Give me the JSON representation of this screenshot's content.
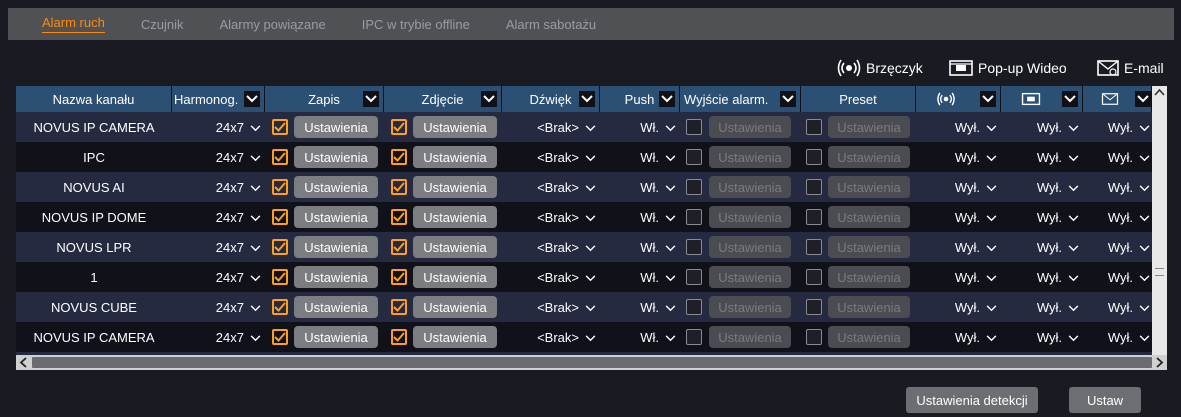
{
  "tabs": [
    "Alarm ruch",
    "Czujnik",
    "Alarmy powiązane",
    "IPC w trybie offline",
    "Alarm sabotażu"
  ],
  "legend": {
    "buzzer": "Brzęczyk",
    "popup": "Pop-up Wideo",
    "email": "E-mail"
  },
  "headers": {
    "channel": "Nazwa kanału",
    "schedule": "Harmonog.",
    "record": "Zapis",
    "snapshot": "Zdjęcie",
    "sound": "Dźwięk",
    "push": "Push",
    "alarm_out": "Wyjście alarm.",
    "preset": "Preset"
  },
  "rows": [
    {
      "name": "NOVUS IP CAMERA",
      "schedule": "24x7",
      "record_btn": "Ustawienia",
      "snap_btn": "Ustawienia",
      "sound": "<Brak>",
      "push": "Wł.",
      "out_btn": "Ustawienia",
      "preset_btn": "Ustawienia",
      "buzzer": "Wył.",
      "popup": "Wył.",
      "email": "Wył."
    },
    {
      "name": "IPC",
      "schedule": "24x7",
      "record_btn": "Ustawienia",
      "snap_btn": "Ustawienia",
      "sound": "<Brak>",
      "push": "Wł.",
      "out_btn": "Ustawienia",
      "preset_btn": "Ustawienia",
      "buzzer": "Wył.",
      "popup": "Wył.",
      "email": "Wył."
    },
    {
      "name": "NOVUS AI",
      "schedule": "24x7",
      "record_btn": "Ustawienia",
      "snap_btn": "Ustawienia",
      "sound": "<Brak>",
      "push": "Wł.",
      "out_btn": "Ustawienia",
      "preset_btn": "Ustawienia",
      "buzzer": "Wył.",
      "popup": "Wył.",
      "email": "Wył."
    },
    {
      "name": "NOVUS IP DOME",
      "schedule": "24x7",
      "record_btn": "Ustawienia",
      "snap_btn": "Ustawienia",
      "sound": "<Brak>",
      "push": "Wł.",
      "out_btn": "Ustawienia",
      "preset_btn": "Ustawienia",
      "buzzer": "Wył.",
      "popup": "Wył.",
      "email": "Wył."
    },
    {
      "name": "NOVUS LPR",
      "schedule": "24x7",
      "record_btn": "Ustawienia",
      "snap_btn": "Ustawienia",
      "sound": "<Brak>",
      "push": "Wł.",
      "out_btn": "Ustawienia",
      "preset_btn": "Ustawienia",
      "buzzer": "Wył.",
      "popup": "Wył.",
      "email": "Wył."
    },
    {
      "name": "1",
      "schedule": "24x7",
      "record_btn": "Ustawienia",
      "snap_btn": "Ustawienia",
      "sound": "<Brak>",
      "push": "Wł.",
      "out_btn": "Ustawienia",
      "preset_btn": "Ustawienia",
      "buzzer": "Wył.",
      "popup": "Wył.",
      "email": "Wył."
    },
    {
      "name": "NOVUS CUBE",
      "schedule": "24x7",
      "record_btn": "Ustawienia",
      "snap_btn": "Ustawienia",
      "sound": "<Brak>",
      "push": "Wł.",
      "out_btn": "Ustawienia",
      "preset_btn": "Ustawienia",
      "buzzer": "Wył.",
      "popup": "Wył.",
      "email": "Wył."
    },
    {
      "name": "NOVUS IP CAMERA",
      "schedule": "24x7",
      "record_btn": "Ustawienia",
      "snap_btn": "Ustawienia",
      "sound": "<Brak>",
      "push": "Wł.",
      "out_btn": "Ustawienia",
      "preset_btn": "Ustawienia",
      "buzzer": "Wył.",
      "popup": "Wył.",
      "email": "Wył."
    }
  ],
  "footer": {
    "detect": "Ustawienia detekcji",
    "apply": "Ustaw"
  },
  "colors": {
    "accent": "#ff8c00",
    "header": "#2c4f74",
    "row_alt": "#262a40"
  }
}
